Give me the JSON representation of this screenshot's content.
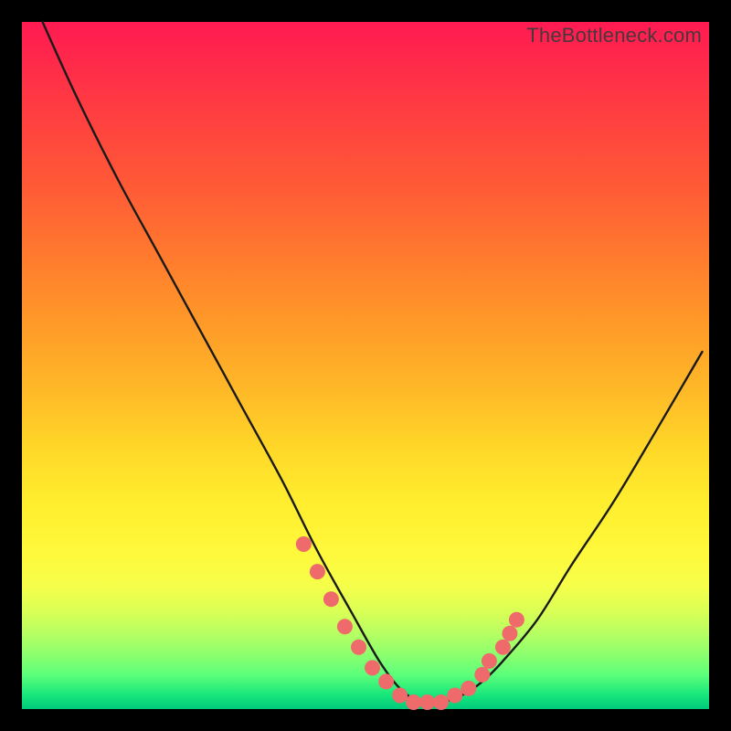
{
  "watermark": "TheBottleneck.com",
  "colors": {
    "background": "#000000",
    "curve_stroke": "#1a1a1a",
    "marker_fill": "#ef6a6a",
    "marker_stroke": "#d84c4c"
  },
  "chart_data": {
    "type": "line",
    "title": "",
    "xlabel": "",
    "ylabel": "",
    "xlim": [
      0,
      100
    ],
    "ylim": [
      0,
      100
    ],
    "grid": false,
    "legend": false,
    "note": "Axes are unlabeled; values estimated from pixel positions on a 0–100 normalized scale (x left→right, y bottom→top). Curve is a V-shaped bottleneck profile with minimum near x≈55–60.",
    "series": [
      {
        "name": "curve",
        "x": [
          3,
          8,
          14,
          20,
          26,
          32,
          38,
          43,
          48,
          52,
          55,
          58,
          61,
          64,
          67,
          70,
          75,
          80,
          86,
          92,
          99
        ],
        "y": [
          100,
          89,
          77,
          66,
          55,
          44,
          33,
          23,
          14,
          7,
          3,
          1,
          1,
          2,
          4,
          7,
          13,
          21,
          30,
          40,
          52
        ]
      }
    ],
    "markers": {
      "name": "highlighted-points",
      "x": [
        41,
        43,
        45,
        47,
        49,
        51,
        53,
        55,
        57,
        59,
        61,
        63,
        65,
        67,
        68,
        70,
        71,
        72
      ],
      "y": [
        24,
        20,
        16,
        12,
        9,
        6,
        4,
        2,
        1,
        1,
        1,
        2,
        3,
        5,
        7,
        9,
        11,
        13
      ]
    }
  }
}
